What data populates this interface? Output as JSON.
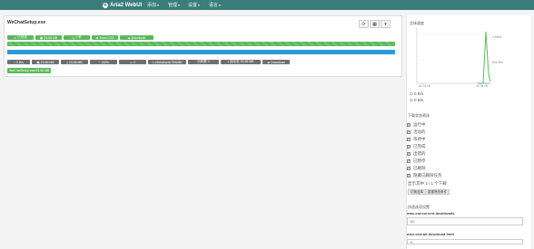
{
  "navbar": {
    "brand": "Aria2 WebUI",
    "items": [
      {
        "label": "添加"
      },
      {
        "label": "管理"
      },
      {
        "label": "设置"
      },
      {
        "label": "语言"
      }
    ]
  },
  "task": {
    "name": "WeChatSetup.exe",
    "row1": [
      {
        "icon": "check-icon",
        "label": "已完成"
      },
      {
        "icon": "hdd-icon",
        "label": "23.56 MB"
      },
      {
        "icon": "clock-icon",
        "label": "0 秒"
      },
      {
        "icon": "share-icon",
        "label": "Seed 0.00"
      },
      {
        "icon": "folder-icon",
        "label": "Download"
      }
    ],
    "row2": [
      {
        "icon": "arrow-down-icon",
        "label": "0 B/s"
      },
      {
        "icon": "hdd-icon",
        "label": "23.56 MB"
      },
      {
        "icon": "download-icon",
        "label": "23.56 MB"
      },
      {
        "icon": "percent-icon",
        "label": "100%"
      },
      {
        "icon": "users-icon",
        "label": "0"
      },
      {
        "icon": "tag-icon",
        "label": "c3b0d0a4b7f05df5f"
      },
      {
        "icon": "pieces-icon",
        "label": "切块数 0"
      },
      {
        "icon": "upload-icon",
        "label": "保存至 23.56 MB"
      },
      {
        "icon": "folder-icon",
        "label": "Download"
      }
    ],
    "link": "WeChatSetup.exe/23.56 MB"
  },
  "sidebar": {
    "speed_title": "总体速度",
    "chart_ticks": {
      "y": [
        "1 KB/s",
        "500 B/s"
      ],
      "x": [
        "11:01:00",
        "11:04:00"
      ],
      "x_sub": [
        "2023",
        "ago"
      ]
    },
    "speed_down": "0 B/s",
    "speed_up": "0 B/s",
    "filter_title": "下载状态筛选",
    "filters": [
      "运行中",
      "活动的",
      "等待中",
      "已完成",
      "出错的",
      "已暂停",
      "已删除",
      "隐藏已删除任务"
    ],
    "count_text": "显示其中 1 / 1 个下载",
    "buttons": [
      "切换选择",
      "重置筛选条件"
    ],
    "quick_title": "快速选项设置",
    "field1_label": "max-concurrent-downloads",
    "field1_value": "50",
    "field2_label": "max-overall-download-limit",
    "field2_value": "0"
  },
  "colors": {
    "navbar": "#3a7d7b",
    "success": "#5cb85c",
    "info": "#2d9ad8",
    "neutral": "#6f6f6f"
  }
}
